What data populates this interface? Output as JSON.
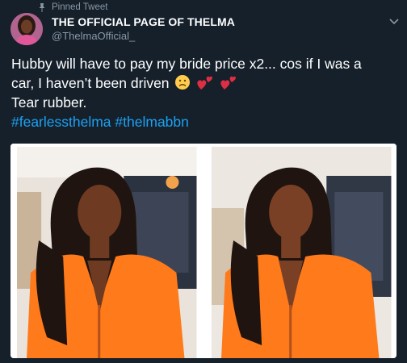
{
  "pinned": {
    "label": "Pinned Tweet",
    "icon": "pin-icon"
  },
  "author": {
    "display_name": "THE OFFICIAL PAGE OF THELMA",
    "handle": "@ThelmaOfficial_",
    "avatar": "avatar"
  },
  "tweet": {
    "line1": "Hubby will have to pay my bride price x2... cos if I was a",
    "line2": "car, I haven’t been driven",
    "line3": "Tear rubber.",
    "hashtag1": "#fearlessthelma",
    "hashtag2": "#thelmabbn"
  },
  "media": [
    {
      "name": "photo-1",
      "alt": ""
    },
    {
      "name": "photo-2",
      "alt": ""
    }
  ],
  "colors": {
    "background": "#15202b",
    "secondary_text": "#8899a6",
    "link": "#1da1f2",
    "orange_outfit": "#ff7a1a"
  }
}
